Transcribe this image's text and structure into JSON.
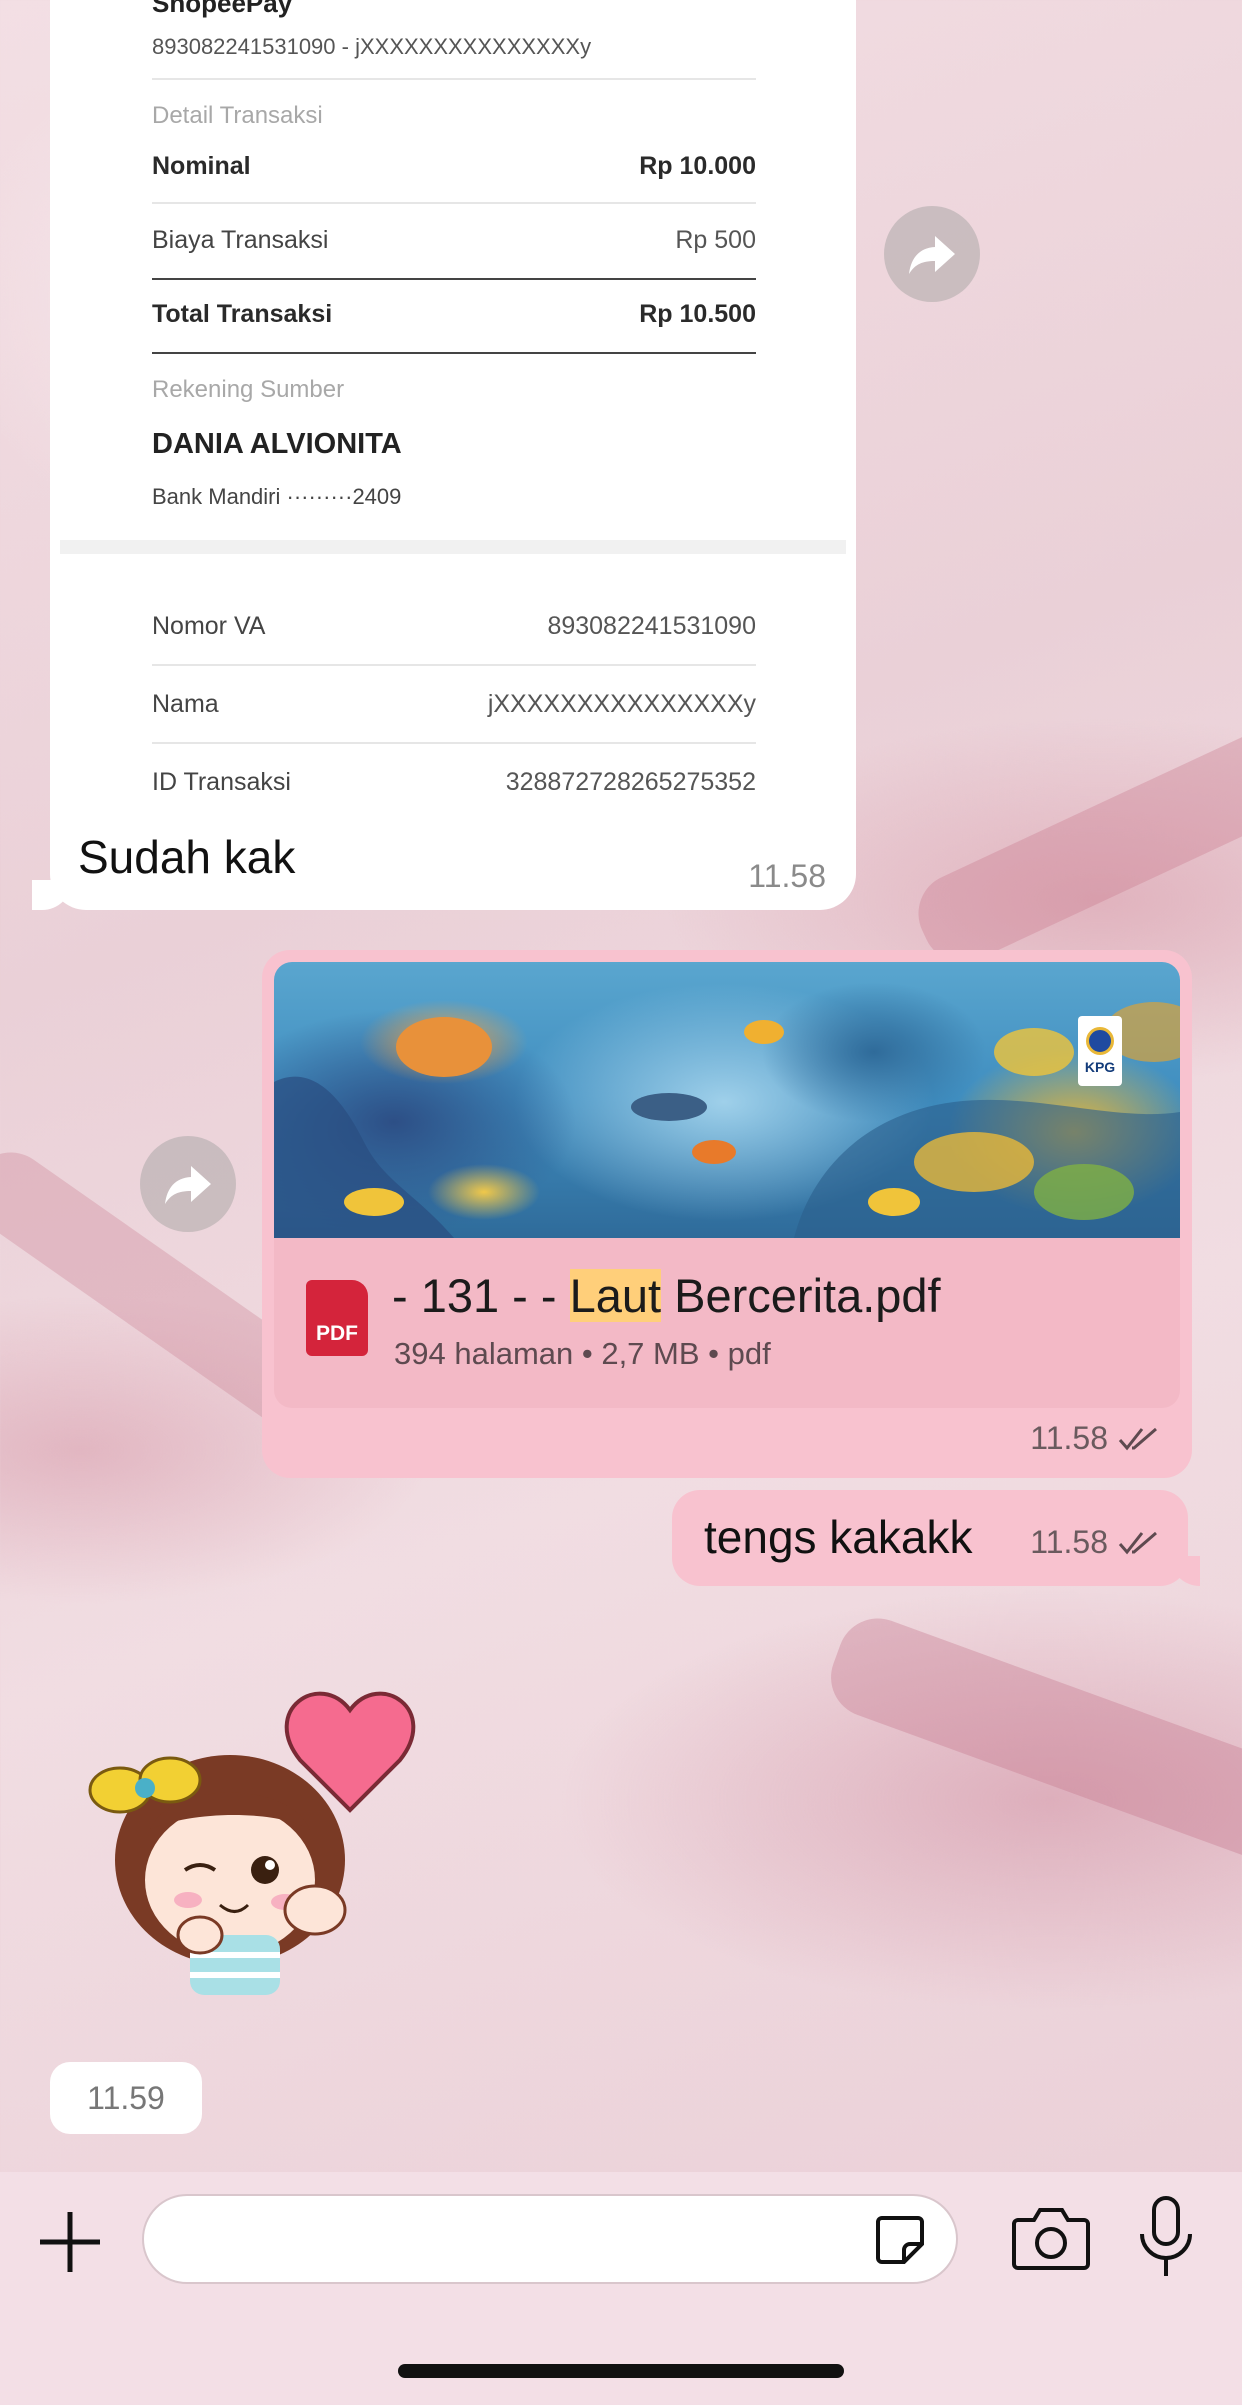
{
  "received_message": {
    "receipt": {
      "header_title": "ShopeePay",
      "header_subtitle": "893082241531090 - jXXXXXXXXXXXXXXXy",
      "detail_section": "Detail Transaksi",
      "rows": [
        {
          "label": "Nominal",
          "value": "Rp 10.000"
        },
        {
          "label": "Biaya Transaksi",
          "value": "Rp 500"
        },
        {
          "label": "Total Transaksi",
          "value": "Rp 10.500"
        }
      ],
      "source_section": "Rekening Sumber",
      "account_name": "DANIA ALVIONITA",
      "account_bank": "Bank Mandiri  ·········2409",
      "info_rows": [
        {
          "label": "Nomor VA",
          "value": "893082241531090"
        },
        {
          "label": "Nama",
          "value": "jXXXXXXXXXXXXXXXy"
        },
        {
          "label": "ID Transaksi",
          "value": "328872728265275352"
        }
      ]
    },
    "caption": "Sudah kak",
    "time": "11.58"
  },
  "document_message": {
    "title_prefix": "- 131 - - ",
    "title_highlight": "Laut",
    "title_suffix": " Bercerita.pdf",
    "meta": "394 halaman • 2,7 MB • pdf",
    "file_badge": "PDF",
    "cover_logo": "KPG",
    "time": "11.58",
    "status_icon": "double-check-icon"
  },
  "text_message": {
    "text": "tengs kakakk",
    "time": "11.58",
    "status_icon": "double-check-icon"
  },
  "sticker_message": {
    "sticker": "girl-heart-sticker",
    "time": "11.59"
  },
  "input_bar": {
    "placeholder": "",
    "icons": [
      "plus-icon",
      "sticker-icon",
      "camera-icon",
      "microphone-icon"
    ]
  },
  "colors": {
    "sent_bubble": "#f8c2cf",
    "received_bubble": "#ffffff",
    "highlight": "#ffcf7a",
    "pdf_red": "#d4243b"
  }
}
